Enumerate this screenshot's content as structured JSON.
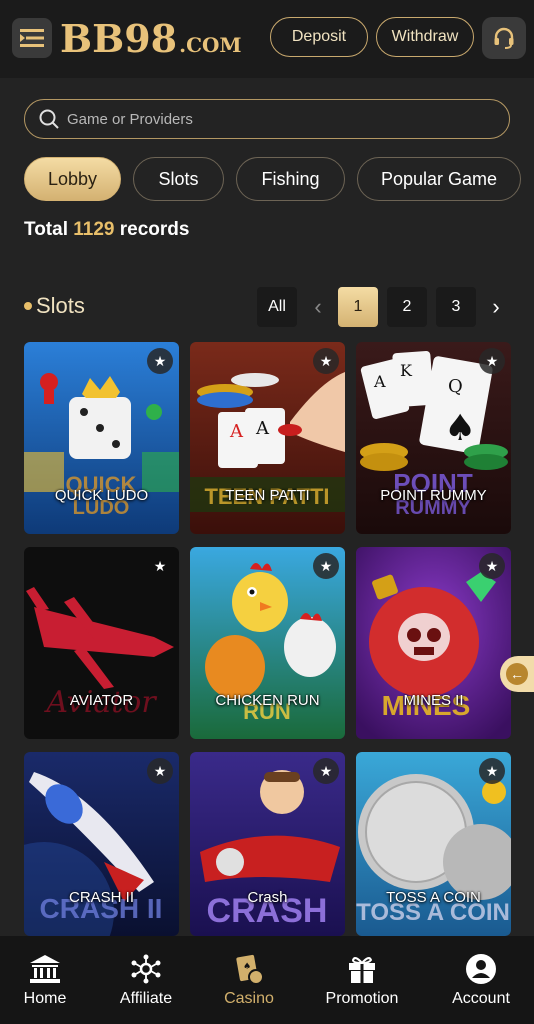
{
  "header": {
    "logo_main": "BB98",
    "logo_suffix": ".COM",
    "deposit_label": "Deposit",
    "withdraw_label": "Withdraw"
  },
  "search": {
    "placeholder": "Game or Providers"
  },
  "tabs": [
    {
      "label": "Lobby",
      "active": true
    },
    {
      "label": "Slots"
    },
    {
      "label": "Fishing"
    },
    {
      "label": "Popular Game"
    }
  ],
  "summary": {
    "prefix": "Total",
    "count": "1129",
    "suffix": "records"
  },
  "section": {
    "title": "Slots",
    "pagination": {
      "all": "All",
      "pages": [
        "1",
        "2",
        "3"
      ],
      "current": "1"
    }
  },
  "games": [
    {
      "name": "QUICK LUDO"
    },
    {
      "name": "TEEN PATTI"
    },
    {
      "name": "POINT RUMMY"
    },
    {
      "name": "AVIATOR"
    },
    {
      "name": "CHICKEN RUN"
    },
    {
      "name": "MINES II"
    },
    {
      "name": "CRASH II"
    },
    {
      "name": "Crash"
    },
    {
      "name": "TOSS A COIN"
    }
  ],
  "bottom_nav": [
    {
      "label": "Home",
      "icon": "bank-icon"
    },
    {
      "label": "Affiliate",
      "icon": "network-icon"
    },
    {
      "label": "Casino",
      "icon": "cards-icon",
      "active": true
    },
    {
      "label": "Promotion",
      "icon": "gift-icon"
    },
    {
      "label": "Account",
      "icon": "user-icon"
    }
  ],
  "colors": {
    "accent": "#d4b272",
    "background": "#232323",
    "count_highlight": "#e8bf6a"
  }
}
